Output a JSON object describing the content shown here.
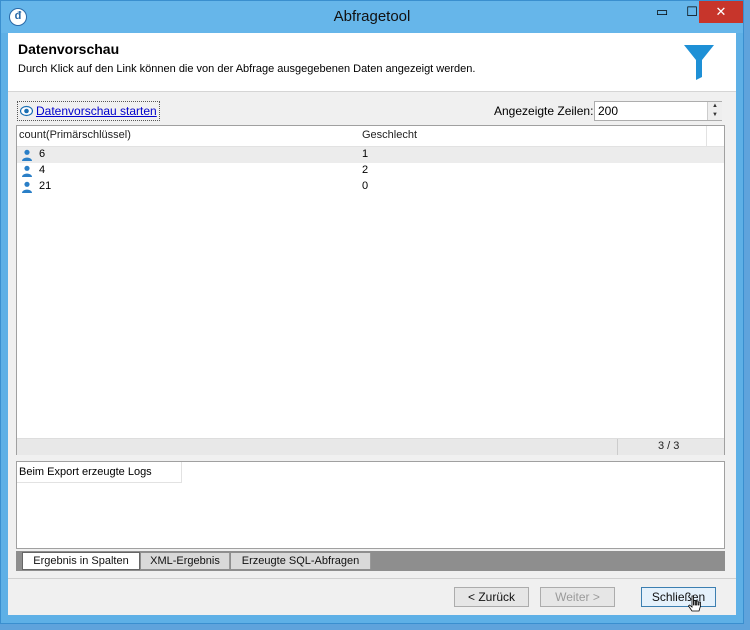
{
  "window": {
    "title": "Abfragetool",
    "controls": {
      "minimize": "▭",
      "maximize": "☐",
      "close": "✕"
    }
  },
  "header": {
    "title": "Datenvorschau",
    "description": "Durch Klick auf den Link können die von der Abfrage ausgegebenen Daten angezeigt werden.",
    "icon": "funnel-icon"
  },
  "preview": {
    "link_label": "Datenvorschau starten",
    "rows_label": "Angezeigte Zeilen:",
    "rows_value": "200"
  },
  "grid": {
    "columns": [
      "count(Primärschlüssel)",
      "Geschlecht"
    ],
    "rows": [
      {
        "count": "6",
        "gender": "1"
      },
      {
        "count": "4",
        "gender": "2"
      },
      {
        "count": "21",
        "gender": "0"
      }
    ],
    "page_count": "3 / 3"
  },
  "logs": {
    "title": "Beim Export erzeugte Logs"
  },
  "tabs": [
    {
      "label": "Ergebnis in Spalten",
      "active": true
    },
    {
      "label": "XML-Ergebnis",
      "active": false
    },
    {
      "label": "Erzeugte SQL-Abfragen",
      "active": false
    }
  ],
  "buttons": {
    "back": "< Zurück",
    "next": "Weiter >",
    "close": "Schließen"
  },
  "colors": {
    "title_bar": "#66b6ea",
    "link": "#0000cc",
    "accent_icon": "#1e90d6",
    "close_button": "#c7352b"
  }
}
